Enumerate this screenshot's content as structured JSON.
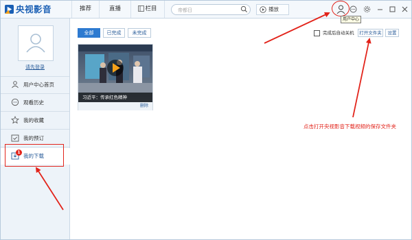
{
  "app": {
    "logo_text": "央视影音",
    "brand_color": "#1a5fb4"
  },
  "nav": {
    "tabs": [
      "推荐",
      "直播",
      "栏目"
    ]
  },
  "search": {
    "placeholder": "帝都日"
  },
  "play_button": {
    "label": "播放"
  },
  "tooltip": {
    "text": "用户中心"
  },
  "sidebar": {
    "login_link": "请先登录",
    "items": [
      {
        "label": "用户中心首页",
        "icon": "user-icon"
      },
      {
        "label": "观看历史",
        "icon": "history-icon"
      },
      {
        "label": "我的收藏",
        "icon": "star-icon"
      },
      {
        "label": "我的预订",
        "icon": "calendar-check-icon"
      },
      {
        "label": "我的下载",
        "icon": "download-icon",
        "badge": "1",
        "active": true
      }
    ]
  },
  "filters": {
    "options": [
      "全部",
      "已完成",
      "未完成"
    ],
    "selected": "全部"
  },
  "toolbar": {
    "auto_shutdown_label": "完成后自动关机",
    "auto_shutdown_checked": false,
    "open_folder_label": "打开文件夹",
    "settings_label": "设置"
  },
  "downloads": [
    {
      "title": "习近平：传承红色精神",
      "action": "删除"
    }
  ],
  "annotation": {
    "text": "点击打开央视影音下载视频的保存文件夹",
    "color": "#e2231a"
  },
  "colors": {
    "accent": "#2d7ad0",
    "annotation_red": "#e2231a",
    "sidebar_bg": "#edf3f9"
  }
}
